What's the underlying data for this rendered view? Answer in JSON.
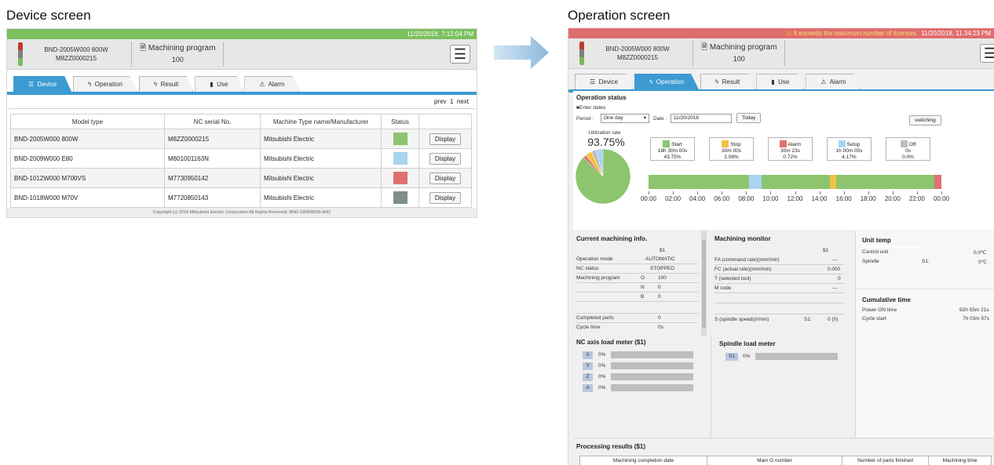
{
  "left_caption": "Device screen",
  "right_caption": "Operation screen",
  "device_screen": {
    "datetime": "11/22/2018, 7:12:04 PM",
    "device_name": "BND-2005W000 800W",
    "device_serial": "M8ZZ0000215",
    "program_label": "Machining program",
    "program_number": "100",
    "tabs": [
      "Device",
      "Operation",
      "Result",
      "Use",
      "Alarm"
    ],
    "pager": {
      "prev": "prev",
      "page": "1",
      "next": "next"
    },
    "columns": [
      "Model type",
      "NC serial No.",
      "Machine Type name/Manufacturer",
      "Status",
      ""
    ],
    "rows": [
      {
        "model": "BND-2005W000 800W",
        "serial": "M8ZZ0000215",
        "maker": "Mitsubishi Electric",
        "status_color": "#8cc56d",
        "action": "Display"
      },
      {
        "model": "BND-2009W000 E80",
        "serial": "M801001163N",
        "maker": "Mitsubishi Electric",
        "status_color": "#a9d4f0",
        "action": "Display"
      },
      {
        "model": "BND-1012W000 M700VS",
        "serial": "M7730950142",
        "maker": "Mitsubishi Electric",
        "status_color": "#e07070",
        "action": "Display"
      },
      {
        "model": "BND-1018W000 M70V",
        "serial": "M7720850143",
        "maker": "Mitsubishi Electric",
        "status_color": "#7e8c8c",
        "action": "Display"
      }
    ],
    "copyright": "Copyright (c) 2018 Mitsubishi Electric Corporation All Rights Reserved. BND-1808W000-A0D"
  },
  "operation_screen": {
    "warning": "It exceeds the maximum number of licenses.",
    "datetime": "11/20/2018, 11:34:23 PM",
    "device_name": "BND-2005W000 800W",
    "device_serial": "M8ZZ0000215",
    "program_label": "Machining program",
    "program_number": "100",
    "tabs": [
      "Device",
      "Operation",
      "Result",
      "Use",
      "Alarm"
    ],
    "status": {
      "title": "Operation status",
      "enter_dates": "■Enter dates",
      "period_label": "Period :",
      "period_value": "One day",
      "date_label": "Date :",
      "date_value": "11/20/2018",
      "today": "Today",
      "switching": "switching",
      "util_label": "Utilization rate",
      "util_value": "93.75%"
    },
    "legend": [
      {
        "name": "Start",
        "time": "18h 30m 00s",
        "pct": "43.75%",
        "color": "#8cc56d"
      },
      {
        "name": "Stop",
        "time": "30m 00s",
        "pct": "2.08%",
        "color": "#f3c244"
      },
      {
        "name": "Alarm",
        "time": "30m 23s",
        "pct": "0.72%",
        "color": "#e07070"
      },
      {
        "name": "Setup",
        "time": "1h 00m 00s",
        "pct": "4.17%",
        "color": "#a9d4f0"
      },
      {
        "name": "Off",
        "time": "0s",
        "pct": "0.0%",
        "color": "#bdbdbd"
      }
    ],
    "timeline_ticks": [
      "00:00",
      "02:00",
      "04:00",
      "06:00",
      "08:00",
      "10:00",
      "12:00",
      "14:00",
      "16:00",
      "18:00",
      "20:00",
      "22:00",
      "00:00"
    ],
    "current": {
      "title": "Current machining info.",
      "col": "$1",
      "mode_label": "Operation mode",
      "mode_value": "AUTOMATIC",
      "nc_label": "NC status",
      "nc_value": "STOPPED",
      "prog_label": "Machining program",
      "o_label": "O",
      "o_value": "100",
      "n_label": "N",
      "n_value": "0",
      "b_label": "B",
      "b_value": "0",
      "parts_label": "Completed parts",
      "parts_value": "0",
      "cycle_label": "Cycle time",
      "cycle_value": "0s"
    },
    "monitor": {
      "title": "Machining monitor",
      "col": "$1",
      "fa_label": "FA (command rate)(mm/min)",
      "fa_value": "---",
      "fc_label": "FC (actual rate)(mm/min)",
      "fc_value": "0.000",
      "t_label": "T (selected tool)",
      "t_value": "0",
      "m_label": "M code",
      "m_value": "---",
      "s_label": "S (spindle speed)(r/min)",
      "s_axis": "S1:",
      "s_value": "0 (0)"
    },
    "unit_temp": {
      "title": "Unit temp",
      "control_label": "Control unit",
      "control_value": "0.0℃",
      "spindle_label": "Spindle",
      "spindle_axis": "S1:",
      "spindle_value": "0℃"
    },
    "cumulative": {
      "title": "Cumulative time",
      "power_label": "Power ON time",
      "power_value": "92h 55m 21s",
      "cycle_label": "Cycle start",
      "cycle_value": "7h 03m 57s"
    },
    "nc_load": {
      "title": "NC axis load meter ($1)",
      "axes": [
        {
          "name": "X",
          "pct": "0%"
        },
        {
          "name": "Y",
          "pct": "0%"
        },
        {
          "name": "Z",
          "pct": "0%"
        },
        {
          "name": "A",
          "pct": "0%"
        }
      ]
    },
    "spindle_load": {
      "title": "Spindle load meter",
      "axes": [
        {
          "name": "S1",
          "pct": "0%"
        }
      ]
    },
    "results": {
      "title": "Processing results ($1)",
      "columns": [
        "Machining completion date",
        "Main O number",
        "Number of parts finished",
        "Machining time"
      ]
    }
  }
}
